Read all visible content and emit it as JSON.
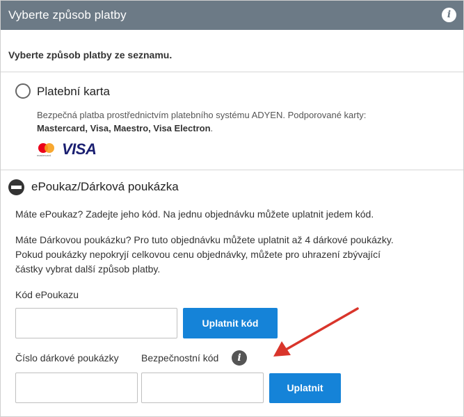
{
  "header": {
    "title": "Vyberte způsob platby",
    "info_icon": "i"
  },
  "intro": "Vyberte způsob platby ze seznamu.",
  "card_option": {
    "title": "Platební karta",
    "description": "Bezpečná platba prostřednictvím platebního systému ADYEN. Podporované karty:",
    "cards_list": "Mastercard, Visa, Maestro, Visa Electron",
    "cards_list_end": ".",
    "mastercard_label": "mastercard",
    "visa_label": "VISA"
  },
  "voucher_option": {
    "title": "ePoukaz/Dárková poukázka",
    "text1": "Máte ePoukaz? Zadejte jeho kód. Na jednu objednávku můžete uplatnit jedem kód.",
    "text2_line1": "Máte Dárkovou poukázku? Pro tuto objednávku můžete uplatnit až 4 dárkové poukázky.",
    "text2_line2": "Pokud poukázky nepokryjí celkovou cenu objednávky, můžete pro uhrazení zbývající",
    "text2_line3": "částky vybrat další způsob platby.",
    "epoukaz_label": "Kód ePoukazu",
    "epoukaz_value": "",
    "apply_code_button": "Uplatnit kód",
    "gift_number_label": "Číslo dárkové poukázky",
    "gift_number_value": "",
    "security_code_label": "Bezpečnostní kód",
    "security_code_value": "",
    "security_info_icon": "i",
    "apply_button": "Uplatnit"
  },
  "colors": {
    "header_bg": "#6c7a86",
    "button_bg": "#1583d8",
    "arrow": "#d9352b"
  },
  "icons": [
    "info-icon",
    "radio-unchecked-icon",
    "minus-circle-icon",
    "mastercard-logo",
    "visa-logo",
    "arrow-annotation"
  ]
}
